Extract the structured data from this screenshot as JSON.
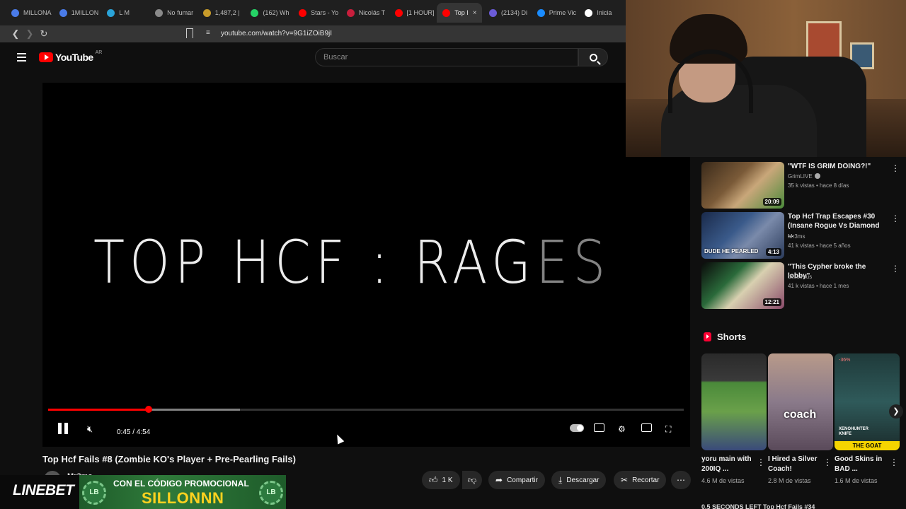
{
  "browser": {
    "tabs": [
      {
        "label": "MILLONA",
        "color": "#4a7be8"
      },
      {
        "label": "1MILLON",
        "color": "#4a7be8"
      },
      {
        "label": "L M",
        "color": "#2aa3d8"
      },
      {
        "label": "No fumar",
        "color": "#8a8a8a"
      },
      {
        "label": "1,487,2 |",
        "color": "#c89b2a"
      },
      {
        "label": "(162) Wh",
        "color": "#25d366"
      },
      {
        "label": "Stars - Yo",
        "color": "#ff0000"
      },
      {
        "label": "Nicolás T",
        "color": "#c81e3c"
      },
      {
        "label": "[1 HOUR]",
        "color": "#ff0000"
      },
      {
        "label": "Top I",
        "color": "#ff0000",
        "active": true
      },
      {
        "label": "(2134) Di",
        "color": "#6b5bd8"
      },
      {
        "label": "Prime Vic",
        "color": "#1a8cff"
      },
      {
        "label": "Inicia",
        "color": "#ffffff"
      }
    ],
    "tab_close": "×",
    "url": "youtube.com/watch?v=9G1iZOiB9jI"
  },
  "header": {
    "logo_text": "YouTube",
    "country": "AR",
    "search_placeholder": "Buscar"
  },
  "player": {
    "overlay_text_main": "TOP HCF : RAG",
    "overlay_text_ghost": "ES",
    "time": "0:45 / 4:54",
    "progress_played": 0.158,
    "progress_buffered": 0.302
  },
  "video": {
    "title": "Top Hcf Fails #8 (Zombie KO's Player + Pre-Pearling Fails)",
    "channel": "Mr3ms",
    "actions": {
      "like": "1 K",
      "share": "Compartir",
      "download": "Descargar",
      "clip": "Recortar"
    }
  },
  "promo": {
    "brand": "LINEBET",
    "line1": "CON EL CÓDIGO PROMOCIONAL",
    "line2": "SILLONNN",
    "chip": "LB"
  },
  "recommendations": [
    {
      "title": "\"WTF IS GRIM DOING?!\"",
      "channel": "GrimLIVE",
      "verified": true,
      "meta": "35 k vistas • hace 8 días",
      "duration": "20:09"
    },
    {
      "title": "Top Hcf Trap Escapes #30 (Insane Rogue Vs Diamond ...",
      "channel": "Mr3ms",
      "verified": false,
      "meta": "41 k vistas • hace 5 años",
      "duration": "4:13",
      "overlay": "DUDE HE PEARLED"
    },
    {
      "title": "\"This Cypher broke the lobby\"",
      "channel": "dessirous",
      "verified": false,
      "meta": "41 k vistas • hace 1 mes",
      "duration": "12:21"
    }
  ],
  "shorts": {
    "label": "Shorts",
    "items": [
      {
        "title": "yoru main with 200IQ ...",
        "meta": "4.6 M de vistas"
      },
      {
        "title": "I Hired a Silver Coach!",
        "meta": "2.8 M de vistas",
        "overlay": "coach"
      },
      {
        "title": "Good Skins in BAD ...",
        "meta": "1.6 M de vistas",
        "badge": "THE GOAT",
        "tag": "XENOHUNTER KNIFE",
        "corner": "-36%"
      }
    ]
  },
  "bottom": "0.5 SECONDS LEFT  Top Hcf Fails #34"
}
